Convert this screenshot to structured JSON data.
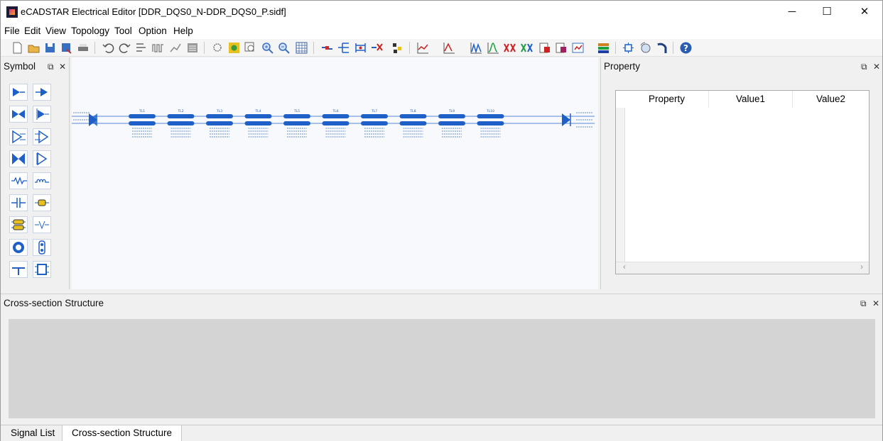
{
  "window": {
    "title": "eCADSTAR Electrical Editor [DDR_DQS0_N-DDR_DQS0_P.sidf]",
    "controls": {
      "minimize": "─",
      "maximize": "☐",
      "close": "✕"
    }
  },
  "menu": {
    "items": [
      {
        "label": "File"
      },
      {
        "label": "Edit"
      },
      {
        "label": "View"
      },
      {
        "label": "Topology"
      },
      {
        "label": "Tool"
      },
      {
        "label": "Option"
      },
      {
        "label": "Help"
      }
    ]
  },
  "toolbar": {
    "icons": [
      "new-file-icon",
      "open-folder-icon",
      "save-icon",
      "save-as-icon",
      "print-icon",
      "undo-icon",
      "redo-icon",
      "align-icon",
      "waveform-icon",
      "route-icon",
      "list-icon",
      "zoom-area-icon",
      "zoom-fit-icon",
      "zoom-window-icon",
      "zoom-in-icon",
      "zoom-out-icon",
      "grid-icon",
      "connect-icon",
      "branch-icon",
      "net-icon",
      "delete-net-icon",
      "cluster-icon",
      "chart-dropdown-icon",
      "chart-eye-icon",
      "waveform-view-icon",
      "spectrum-icon",
      "xx-icon",
      "crosstalk-icon",
      "report-icon",
      "report2-icon",
      "export-dropdown-icon",
      "layer-stack-icon",
      "settings-icon",
      "rotate-icon",
      "return-icon",
      "help-icon"
    ]
  },
  "symbol_panel": {
    "title": "Symbol",
    "restore_icon": "⧉",
    "close_icon": "✕",
    "buttons": [
      "driver-icon",
      "receiver-icon",
      "bidirectional-icon",
      "driver-diff-icon",
      "diff-driver-icon",
      "diff-receiver-icon",
      "diff-bidir-icon",
      "diff-pair-icon",
      "resistor-icon",
      "inductor-icon",
      "capacitor-icon",
      "connector-icon",
      "transmission-line-icon",
      "coupled-line-icon",
      "via-icon",
      "pad-icon",
      "terminator-icon",
      "package-icon"
    ]
  },
  "canvas": {
    "segments": [
      "TL1",
      "TL2",
      "TL3",
      "TL4",
      "TL5",
      "TL6",
      "TL7",
      "TL8",
      "TL9",
      "TL10"
    ],
    "colors": {
      "line": "#1f5fc8",
      "label": "#2a5db0"
    }
  },
  "property_panel": {
    "title": "Property",
    "restore_icon": "⧉",
    "close_icon": "✕",
    "columns": [
      "Property",
      "Value1",
      "Value2"
    ],
    "scroll_left": "‹",
    "scroll_right": "›"
  },
  "cross_section_panel": {
    "title": "Cross-section Structure",
    "restore_icon": "⧉",
    "close_icon": "✕"
  },
  "tabs": [
    {
      "label": "Signal List",
      "active": false
    },
    {
      "label": "Cross-section Structure",
      "active": true
    }
  ]
}
